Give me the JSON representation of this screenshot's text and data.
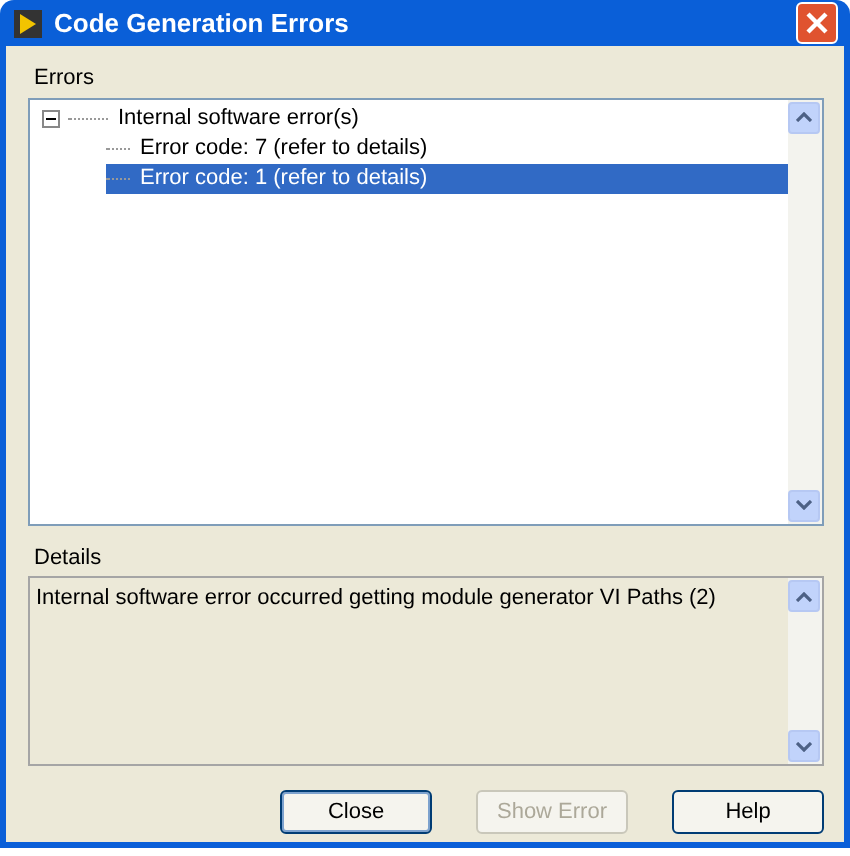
{
  "window": {
    "title": "Code Generation Errors"
  },
  "errors": {
    "label": "Errors",
    "tree": [
      {
        "label": "Internal software error(s)",
        "expanded": true,
        "selected": false,
        "children": [
          {
            "label": "Error code: 7 (refer to details)",
            "selected": false
          },
          {
            "label": "Error code: 1 (refer to details)",
            "selected": true
          }
        ]
      }
    ]
  },
  "details": {
    "label": "Details",
    "text": "Internal software error occurred getting module generator VI Paths (2)"
  },
  "buttons": [
    {
      "label": "Close",
      "disabled": false,
      "default": true
    },
    {
      "label": "Show Error",
      "disabled": true,
      "default": false
    },
    {
      "label": "Help",
      "disabled": false,
      "default": false
    }
  ]
}
